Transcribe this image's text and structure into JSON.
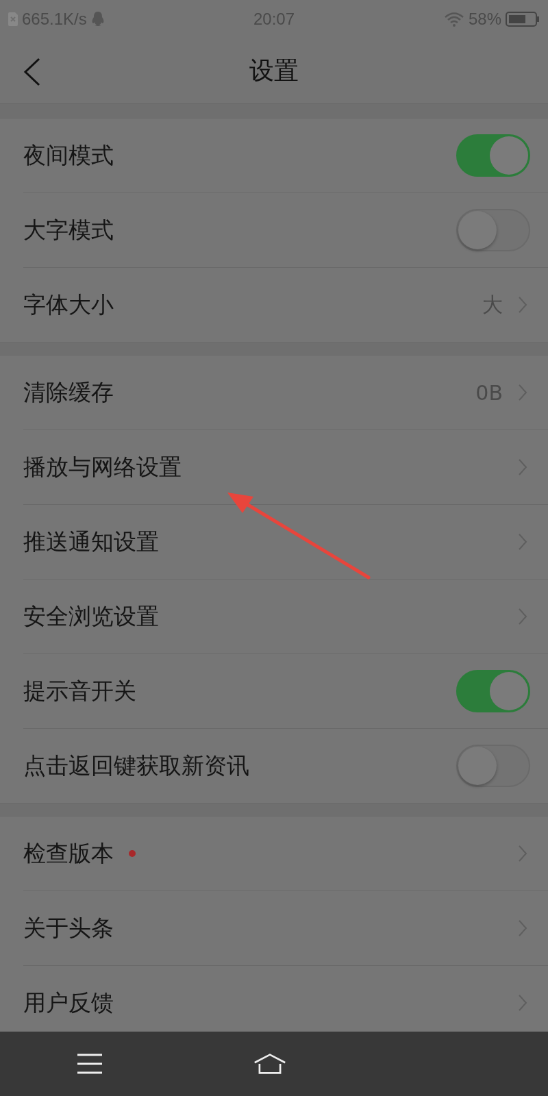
{
  "status_bar": {
    "speed": "665.1K/s",
    "time": "20:07",
    "battery": "58%"
  },
  "header": {
    "title": "设置"
  },
  "groups": [
    {
      "items": [
        {
          "kind": "toggle",
          "label": "夜间模式",
          "on": true
        },
        {
          "kind": "toggle",
          "label": "大字模式",
          "on": false
        },
        {
          "kind": "link",
          "label": "字体大小",
          "value": "大"
        }
      ]
    },
    {
      "items": [
        {
          "kind": "link",
          "label": "清除缓存",
          "value": "0B"
        },
        {
          "kind": "link",
          "label": "播放与网络设置"
        },
        {
          "kind": "link",
          "label": "推送通知设置"
        },
        {
          "kind": "link",
          "label": "安全浏览设置"
        },
        {
          "kind": "toggle",
          "label": "提示音开关",
          "on": true
        },
        {
          "kind": "toggle",
          "label": "点击返回键获取新资讯",
          "on": false
        }
      ]
    },
    {
      "items": [
        {
          "kind": "link",
          "label": "检查版本",
          "new_dot": true
        },
        {
          "kind": "link",
          "label": "关于头条"
        },
        {
          "kind": "link",
          "label": "用户反馈"
        }
      ]
    }
  ],
  "annotation": {
    "kind": "arrow"
  }
}
